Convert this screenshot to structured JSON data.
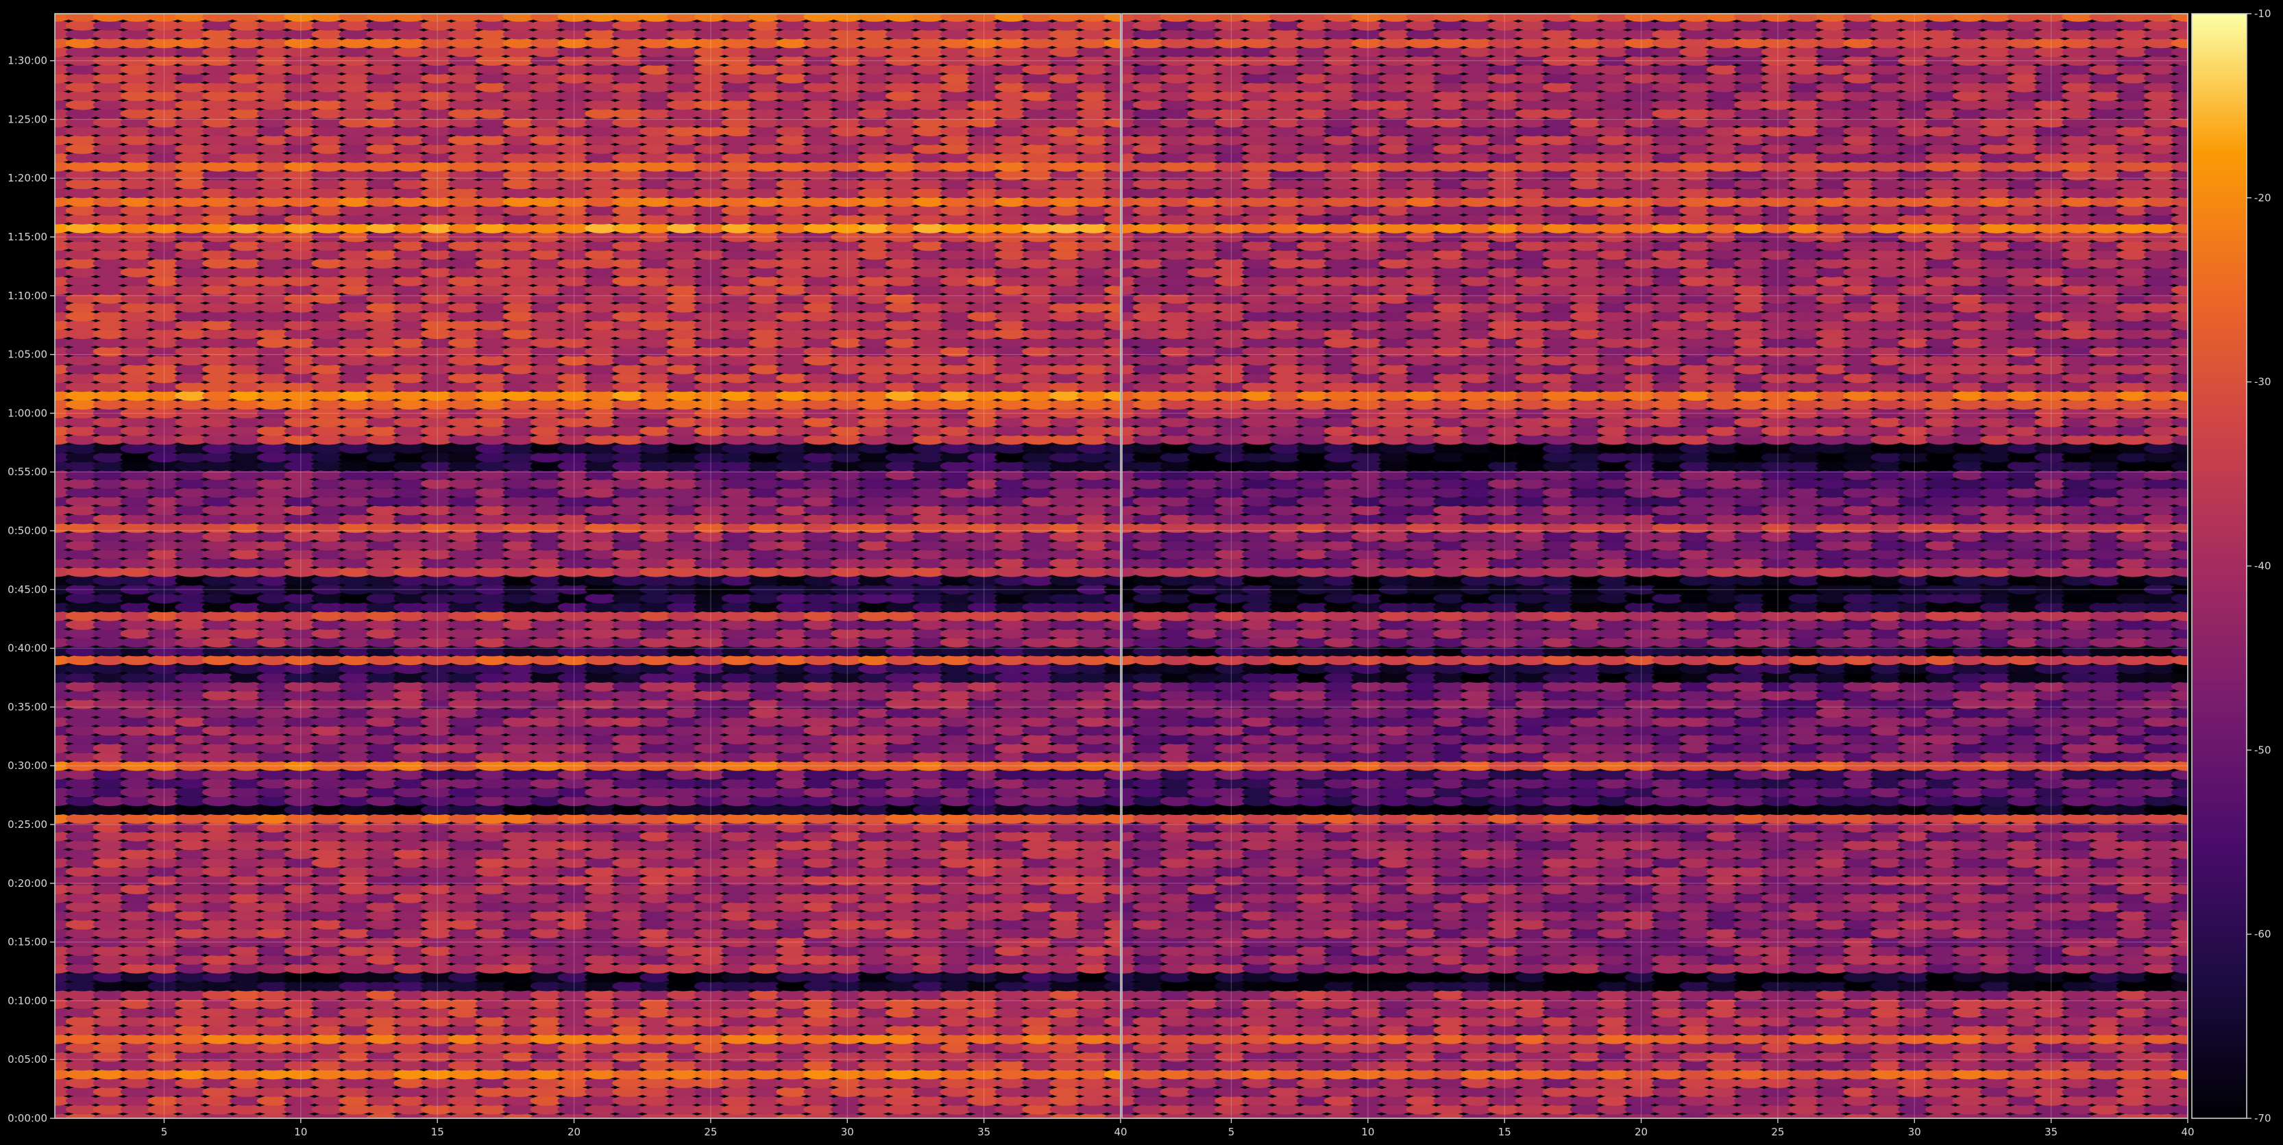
{
  "chart_data": {
    "type": "heatmap",
    "title": "",
    "xlabel": "",
    "ylabel": "",
    "grid": true,
    "legend": "none",
    "colormap": "inferno",
    "colorbar": {
      "range": [
        -70,
        -10
      ],
      "ticks": [
        -10,
        -20,
        -30,
        -40,
        -50,
        -60,
        -70
      ],
      "tick_labels": [
        "-10",
        "-20",
        "-30",
        "-40",
        "-50",
        "-60",
        "-70"
      ],
      "position": "right"
    },
    "panels": [
      {
        "name": "",
        "xlim": [
          1,
          40
        ],
        "x_ticks": [
          5,
          10,
          15,
          20,
          25,
          30,
          35,
          40
        ],
        "x_tick_labels": [
          "5",
          "10",
          "15",
          "20",
          "25",
          "30",
          "35",
          "40"
        ],
        "show_y_labels": true,
        "gain_db": 0
      },
      {
        "name": "",
        "xlim": [
          1,
          40
        ],
        "x_ticks": [
          5,
          10,
          15,
          20,
          25,
          30,
          35,
          40
        ],
        "x_tick_labels": [
          "5",
          "10",
          "15",
          "20",
          "25",
          "30",
          "35",
          "40"
        ],
        "show_y_labels": false,
        "gain_db": -4
      }
    ],
    "y_axis": {
      "range_seconds": [
        0,
        5640
      ],
      "ticks_seconds": [
        0,
        300,
        600,
        900,
        1200,
        1500,
        1800,
        2100,
        2400,
        2700,
        3000,
        3300,
        3600,
        3900,
        4200,
        4500,
        4800,
        5100,
        5400
      ],
      "tick_labels": [
        "0:00:00",
        "0:05:00",
        "0:10:00",
        "0:15:00",
        "0:20:00",
        "0:25:00",
        "0:30:00",
        "0:35:00",
        "0:40:00",
        "0:45:00",
        "0:50:00",
        "0:55:00",
        "1:00:00",
        "1:05:00",
        "1:10:00",
        "1:15:00",
        "1:20:00",
        "1:25:00",
        "1:30:00"
      ]
    },
    "row_step_seconds": 45,
    "bands": [
      {
        "from_seconds": 0,
        "to_seconds": 660,
        "level_db": -36
      },
      {
        "from_seconds": 660,
        "to_seconds": 750,
        "level_db": -64
      },
      {
        "from_seconds": 750,
        "to_seconds": 1500,
        "level_db": -40
      },
      {
        "from_seconds": 1500,
        "to_seconds": 1620,
        "level_db": -66
      },
      {
        "from_seconds": 1620,
        "to_seconds": 1800,
        "level_db": -50
      },
      {
        "from_seconds": 1800,
        "to_seconds": 2220,
        "level_db": -44
      },
      {
        "from_seconds": 2220,
        "to_seconds": 2430,
        "level_db": -60
      },
      {
        "from_seconds": 2430,
        "to_seconds": 2580,
        "level_db": -42
      },
      {
        "from_seconds": 2580,
        "to_seconds": 2790,
        "level_db": -62
      },
      {
        "from_seconds": 2790,
        "to_seconds": 3120,
        "level_db": -42
      },
      {
        "from_seconds": 3120,
        "to_seconds": 3330,
        "level_db": -46
      },
      {
        "from_seconds": 3330,
        "to_seconds": 3450,
        "level_db": -62
      },
      {
        "from_seconds": 3450,
        "to_seconds": 5640,
        "level_db": -36
      }
    ],
    "hot_rows": [
      {
        "t_seconds": 240,
        "level_db": -22
      },
      {
        "t_seconds": 390,
        "level_db": -24
      },
      {
        "t_seconds": 1530,
        "level_db": -26
      },
      {
        "t_seconds": 1780,
        "level_db": -24
      },
      {
        "t_seconds": 2345,
        "level_db": -28
      },
      {
        "t_seconds": 2565,
        "level_db": -32
      },
      {
        "t_seconds": 2800,
        "level_db": -34
      },
      {
        "t_seconds": 3000,
        "level_db": -30
      },
      {
        "t_seconds": 3640,
        "level_db": -26
      },
      {
        "t_seconds": 3690,
        "level_db": -20
      },
      {
        "t_seconds": 4560,
        "level_db": -19
      },
      {
        "t_seconds": 4680,
        "level_db": -24
      },
      {
        "t_seconds": 4840,
        "level_db": -26
      },
      {
        "t_seconds": 5470,
        "level_db": -26
      },
      {
        "t_seconds": 5640,
        "level_db": -24
      }
    ]
  }
}
